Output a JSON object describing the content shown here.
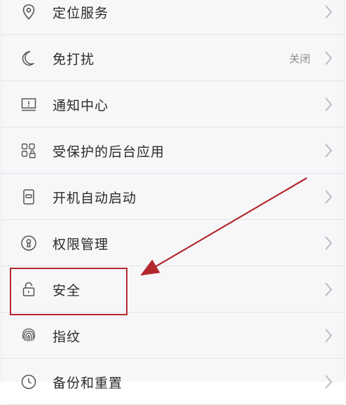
{
  "settings": {
    "items": [
      {
        "label": "定位服务",
        "icon": "location-pin-icon"
      },
      {
        "label": "免打扰",
        "value": "关闭",
        "icon": "moon-icon"
      },
      {
        "label": "通知中心",
        "icon": "notification-tray-icon"
      },
      {
        "label": "受保护的后台应用",
        "icon": "protected-apps-icon"
      },
      {
        "label": "开机自动启动",
        "icon": "autostart-switch-icon"
      },
      {
        "label": "权限管理",
        "icon": "keyhole-icon"
      },
      {
        "label": "安全",
        "icon": "lock-icon"
      },
      {
        "label": "指纹",
        "icon": "fingerprint-icon"
      },
      {
        "label": "备份和重置",
        "icon": "backup-reset-icon"
      }
    ]
  },
  "annotation": {
    "highlight_color": "#b3282d",
    "target_item": "安全"
  }
}
